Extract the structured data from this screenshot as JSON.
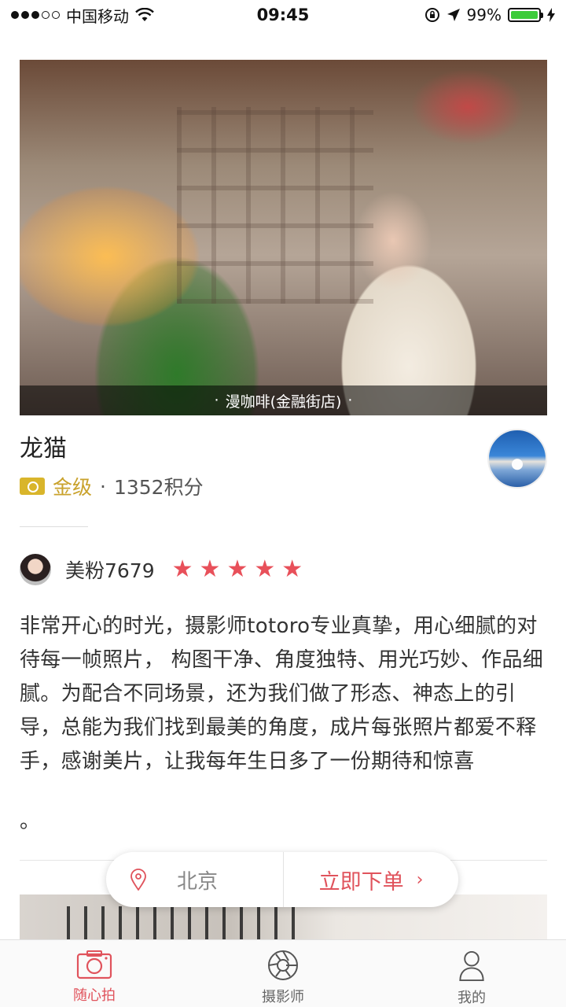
{
  "status_bar": {
    "carrier": "中国移动",
    "time": "09:45",
    "battery": "99%",
    "battery_level": 0.99
  },
  "hero": {
    "caption": "漫咖啡(金融街店)",
    "caption_dot": "·"
  },
  "photographer": {
    "name": "龙猫",
    "level": "金级",
    "separator": "·",
    "points": "1352积分"
  },
  "review": {
    "reviewer_name": "美粉7679",
    "rating": 5,
    "stars": [
      "★",
      "★",
      "★",
      "★",
      "★"
    ],
    "text": "非常开心的时光，摄影师totoro专业真挚，用心细腻的对待每一帧照片， 构图干净、角度独特、用光巧妙、作品细腻。为配合不同场景，还为我们做了形态、神态上的引导，总能为我们找到最美的角度，成片每张照片都爱不释手，感谢美片，让我每年生日多了一份期待和惊喜",
    "text_end": "。"
  },
  "order_bar": {
    "city": "北京",
    "order_label": "立即下单",
    "chevron": "›"
  },
  "tabs": [
    {
      "label": "随心拍",
      "icon": "camera-icon",
      "active": true
    },
    {
      "label": "摄影师",
      "icon": "aperture-icon",
      "active": false
    },
    {
      "label": "我的",
      "icon": "person-icon",
      "active": false
    }
  ],
  "colors": {
    "accent": "#e0535c",
    "gold": "#c9a22c",
    "star": "#e8505a"
  }
}
